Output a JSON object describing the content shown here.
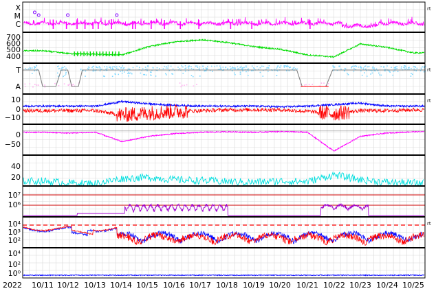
{
  "chart_data": [
    {
      "type": "line",
      "panel": "xray-flare-class",
      "y_tick_labels": [
        "X",
        "M",
        "C"
      ],
      "right_label": "rt",
      "series": [
        {
          "color": "#ff00ff"
        }
      ],
      "markers": {
        "color": "#8000ff",
        "x": [
          "10/11 04:00",
          "10/11 06:00",
          "10/12 12:00",
          "10/13 19:00"
        ]
      }
    },
    {
      "type": "line",
      "panel": "solar-wind-speed",
      "y_tick_labels": [
        "700",
        "600",
        "500",
        "400"
      ],
      "ylim": [
        300,
        750
      ],
      "series": [
        {
          "color": "#00dd00"
        }
      ],
      "approx_values": {
        "x": [
          "10/11",
          "10/12",
          "10/13",
          "10/14",
          "10/15",
          "10/16",
          "10/17",
          "10/18",
          "10/19",
          "10/20",
          "10/21",
          "10/22",
          "10/23",
          "10/24",
          "10/25"
        ],
        "y": [
          480,
          440,
          430,
          420,
          540,
          610,
          640,
          600,
          540,
          500,
          420,
          390,
          580,
          530,
          450
        ]
      }
    },
    {
      "type": "line",
      "panel": "sector-polarity",
      "y_tick_labels": [
        "T",
        "A"
      ],
      "right_label": "rt",
      "series": [
        {
          "color": "#80d8ff"
        },
        {
          "color": "#ffb0f0"
        },
        {
          "color": "#808080"
        }
      ]
    },
    {
      "type": "line",
      "panel": "imf",
      "y_tick_labels": [
        "10",
        "0",
        "−10"
      ],
      "ylim": [
        -20,
        20
      ],
      "right_label": "rt",
      "series": [
        {
          "color": "#0000ff"
        },
        {
          "color": "#ff0000"
        }
      ]
    },
    {
      "type": "line",
      "panel": "dst",
      "y_tick_labels": [
        "0",
        "−50"
      ],
      "ylim": [
        -90,
        25
      ],
      "series": [
        {
          "color": "#ff00ff"
        }
      ],
      "approx_values": {
        "x": [
          "10/11",
          "10/12",
          "10/13",
          "10/14",
          "10/15",
          "10/16",
          "10/17",
          "10/18",
          "10/19",
          "10/20",
          "10/21",
          "10/22",
          "10/23",
          "10/24",
          "10/25"
        ],
        "y": [
          -5,
          -8,
          -5,
          -40,
          -20,
          -10,
          -5,
          -3,
          -5,
          -2,
          -5,
          -75,
          -20,
          -8,
          -3
        ]
      }
    },
    {
      "type": "line",
      "panel": "kp-ap",
      "y_tick_labels": [
        "40",
        "20"
      ],
      "ylim": [
        0,
        50
      ],
      "series": [
        {
          "color": "#00e0e0"
        }
      ]
    },
    {
      "type": "line",
      "panel": "electron-flux",
      "y_tick_labels": [
        "10⁷",
        "10⁶"
      ],
      "series": [
        {
          "color": "#a000d0"
        }
      ],
      "hlines_color": "#cc0000"
    },
    {
      "type": "line",
      "panel": "proton-flux",
      "y_tick_labels": [
        "10⁴",
        "10³",
        "10²"
      ],
      "right_label": "rt",
      "series": [
        {
          "color": "#0000ff"
        },
        {
          "color": "#ff0000"
        }
      ],
      "threshold_color": "#ff0000"
    },
    {
      "type": "line",
      "panel": "high-energy-flux",
      "y_tick_labels": [
        "10⁴",
        "10²",
        "10⁰"
      ],
      "series": [
        {
          "color": "#0000ff"
        }
      ]
    }
  ],
  "x_axis": {
    "year_label": "2022",
    "tick_labels": [
      "10/11",
      "10/12",
      "10/13",
      "10/14",
      "10/15",
      "10/16",
      "10/17",
      "10/18",
      "10/19",
      "10/20",
      "10/21",
      "10/22",
      "10/23",
      "10/24",
      "10/25"
    ]
  }
}
